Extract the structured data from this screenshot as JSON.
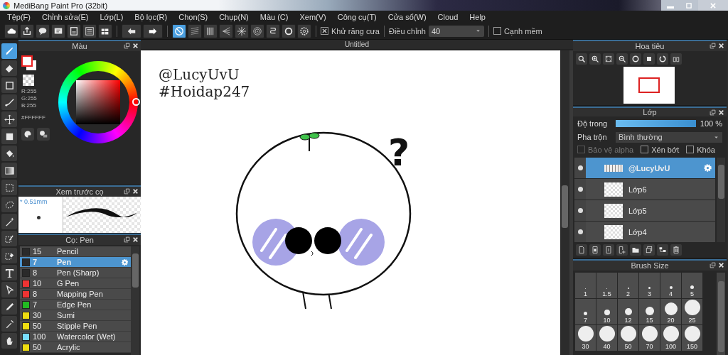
{
  "window": {
    "title": "MediBang Paint Pro (32bit)"
  },
  "menu": [
    "Tệp(F)",
    "Chỉnh sửa(E)",
    "Lớp(L)",
    "Bộ lọc(R)",
    "Chọn(S)",
    "Chụp(N)",
    "Màu (C)",
    "Xem(V)",
    "Công cụ(T)",
    "Cửa sổ(W)",
    "Cloud",
    "Help"
  ],
  "toolbar": {
    "snap_buttons": [
      {
        "selected": true
      },
      {
        "selected": false
      },
      {
        "selected": false
      },
      {
        "selected": false
      },
      {
        "selected": false
      },
      {
        "selected": false
      },
      {
        "selected": false
      },
      {
        "selected": false
      },
      {
        "selected": false
      }
    ],
    "antialias": {
      "label": "Khử răng cưa",
      "checked": true
    },
    "adjust": {
      "label": "Điều chỉnh",
      "value": "40"
    },
    "soft_edge": {
      "label": "Cạnh mềm",
      "checked": false
    }
  },
  "tools": [
    {
      "selected": true
    },
    {
      "selected": false
    },
    {
      "selected": false
    },
    {
      "selected": false
    },
    {
      "selected": false
    },
    {
      "selected": false
    },
    {
      "selected": false
    },
    {
      "selected": false
    },
    {
      "selected": false
    },
    {
      "selected": false
    },
    {
      "selected": false
    },
    {
      "selected": false
    },
    {
      "selected": false
    },
    {
      "selected": false
    },
    {
      "selected": false
    },
    {
      "selected": false
    },
    {
      "selected": false
    },
    {
      "selected": false
    }
  ],
  "color_panel": {
    "title": "Màu",
    "r": "R:255",
    "g": "G:255",
    "b": "B:255",
    "hex": "#FFFFFF"
  },
  "brush_preview": {
    "title": "Xem trước cọ",
    "size": "* 0.51mm"
  },
  "brush_list": {
    "title": "Cọ: Pen",
    "items": [
      {
        "size": "15",
        "name": "Pencil",
        "color": "#2a2a2a",
        "selected": false
      },
      {
        "size": "7",
        "name": "Pen",
        "color": "#2a2a2a",
        "selected": true
      },
      {
        "size": "8",
        "name": "Pen (Sharp)",
        "color": "#2a2a2a",
        "selected": false
      },
      {
        "size": "10",
        "name": "G Pen",
        "color": "#ee3333",
        "selected": false
      },
      {
        "size": "8",
        "name": "Mapping Pen",
        "color": "#ee3333",
        "selected": false
      },
      {
        "size": "7",
        "name": "Edge Pen",
        "color": "#22bb22",
        "selected": false
      },
      {
        "size": "30",
        "name": "Sumi",
        "color": "#eedd11",
        "selected": false
      },
      {
        "size": "50",
        "name": "Stipple Pen",
        "color": "#eedd11",
        "selected": false
      },
      {
        "size": "100",
        "name": "Watercolor (Wet)",
        "color": "#77ddff",
        "selected": false
      },
      {
        "size": "50",
        "name": "Acrylic",
        "color": "#eedd11",
        "selected": false
      }
    ]
  },
  "canvas": {
    "tab": "Untitled",
    "texts": [
      "@LucyUvU",
      "#Hoidap247"
    ],
    "mark": "?"
  },
  "navigator": {
    "title": "Hoa tiêu"
  },
  "layers": {
    "title": "Lớp",
    "opacity": {
      "label": "Độ trong",
      "level": 1,
      "reading": "100 %"
    },
    "blend": {
      "label": "Pha trộn",
      "value": "Bình thường"
    },
    "options": [
      {
        "label": "Bảo vệ alpha",
        "checked": false,
        "disabled": true
      },
      {
        "label": "Xén bớt",
        "checked": false,
        "disabled": false
      },
      {
        "label": "Khóa",
        "checked": false,
        "disabled": false
      }
    ],
    "items": [
      {
        "name": "@LucyUvU",
        "kind": "text",
        "selected": true
      },
      {
        "name": "Lớp6",
        "kind": "raster",
        "selected": false
      },
      {
        "name": "Lớp5",
        "kind": "raster",
        "selected": false
      },
      {
        "name": "Lớp4",
        "kind": "raster",
        "selected": false
      }
    ]
  },
  "brush_size": {
    "title": "Brush Size",
    "sizes": [
      "1",
      "1.5",
      "2",
      "3",
      "4",
      "5",
      "7",
      "10",
      "12",
      "15",
      "20",
      "25",
      "30",
      "40",
      "50",
      "70",
      "100",
      "150"
    ]
  }
}
